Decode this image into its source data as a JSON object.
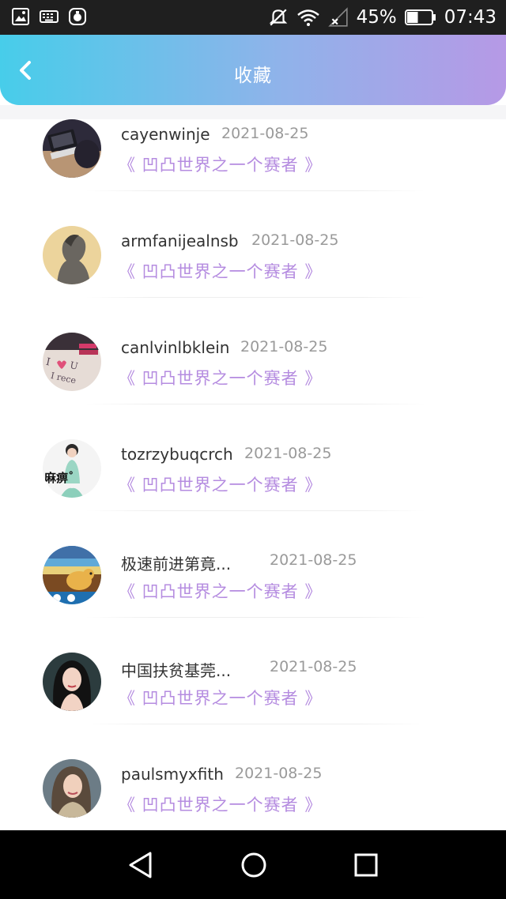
{
  "status_bar": {
    "battery_percent": "45%",
    "time": "07:43",
    "icons": [
      "gallery-icon",
      "keyboard-icon",
      "app-badge-icon",
      "mute-icon",
      "wifi-icon",
      "no-signal-icon",
      "battery-icon"
    ],
    "battery_level": 0.45
  },
  "header": {
    "title": "收藏",
    "back_icon": "chevron-left-icon",
    "colors": {
      "gradient_start": "#47cdea",
      "gradient_end": "#b699e6"
    }
  },
  "list": {
    "items": [
      {
        "username": "cayenwinje",
        "date": "2021-08-25",
        "title": "《 凹凸世界之一个赛者 》"
      },
      {
        "username": "armfanijealnsb",
        "date": "2021-08-25",
        "title": "《 凹凸世界之一个赛者 》"
      },
      {
        "username": "canlvinlbklein",
        "date": "2021-08-25",
        "title": "《 凹凸世界之一个赛者 》"
      },
      {
        "username": "tozrzybuqcrch",
        "date": "2021-08-25",
        "title": "《 凹凸世界之一个赛者 》",
        "avatar_text": "麻痹˚"
      },
      {
        "username": "极速前进第竟...",
        "date": "2021-08-25",
        "title": "《 凹凸世界之一个赛者 》"
      },
      {
        "username": "中国扶贫基莞...",
        "date": "2021-08-25",
        "title": "《 凹凸世界之一个赛者 》"
      },
      {
        "username": "paulsmyxfith",
        "date": "2021-08-25",
        "title": "《 凹凸世界之一个赛者 》"
      }
    ],
    "colors": {
      "title": "#b58ce0",
      "date": "#9a9a9a"
    }
  },
  "nav_bar": {
    "buttons": [
      "back-triangle-icon",
      "home-circle-icon",
      "recents-square-icon"
    ]
  }
}
